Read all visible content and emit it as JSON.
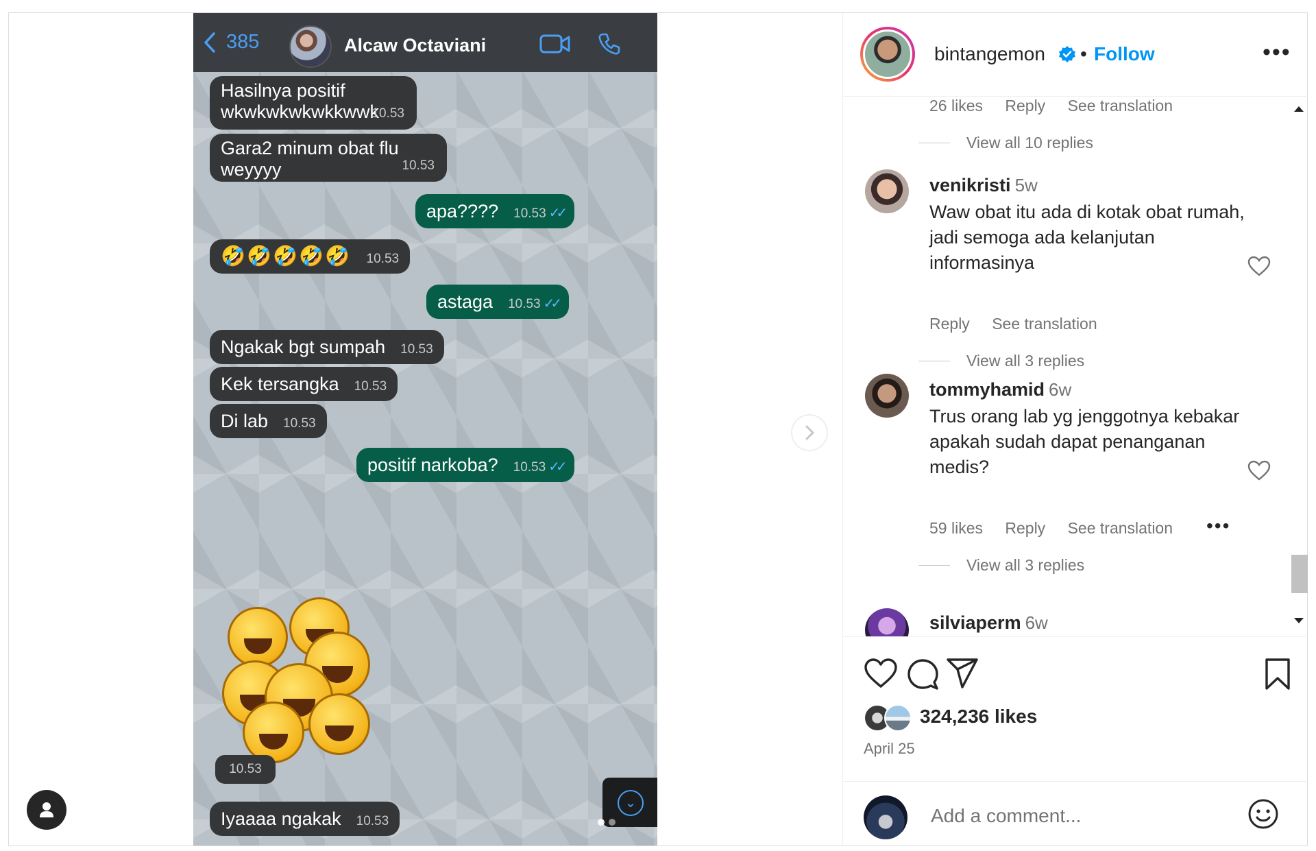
{
  "chat": {
    "unread_count": "385",
    "contact_name": "Alcaw Octaviani",
    "messages": [
      {
        "dir": "in",
        "text_line1": "Hasilnya positif",
        "text_line2": "wkwkwkwkwkkwwk",
        "time": "10.53"
      },
      {
        "dir": "in",
        "text": "Gara2 minum obat flu weyyyy",
        "time": "10.53"
      },
      {
        "dir": "out",
        "text": "apa????",
        "time": "10.53"
      },
      {
        "dir": "in",
        "text": "🤣🤣🤣🤣🤣",
        "time": "10.53"
      },
      {
        "dir": "out",
        "text": "astaga",
        "time": "10.53"
      },
      {
        "dir": "in",
        "text": "Ngakak bgt sumpah",
        "time": "10.53"
      },
      {
        "dir": "in",
        "text": "Kek tersangka",
        "time": "10.53"
      },
      {
        "dir": "in",
        "text": "Di lab",
        "time": "10.53"
      },
      {
        "dir": "out",
        "text": "positif narkoba?",
        "time": "10.53"
      },
      {
        "dir": "in",
        "text": "sticker",
        "time": "10.53"
      },
      {
        "dir": "in",
        "text": "Iyaaaa ngakak",
        "time": "10.53"
      }
    ]
  },
  "post": {
    "owner": "bintangemon",
    "separator": "•",
    "follow_label": "Follow",
    "more_label": "•••",
    "likes": "324,236 likes",
    "date": "April 25",
    "comment_placeholder": "Add a comment..."
  },
  "comments": {
    "top_meta": {
      "likes": "26 likes",
      "reply": "Reply",
      "translate": "See translation"
    },
    "top_replies": "View all 10 replies",
    "items": [
      {
        "user": "venikristi",
        "time": "5w",
        "text": "Waw obat itu ada di kotak obat rumah, jadi semoga ada kelanjutan informasinya",
        "reply": "Reply",
        "translate": "See translation",
        "replies": "View all 3 replies"
      },
      {
        "user": "tommyhamid",
        "time": "6w",
        "text": "Trus orang lab yg jenggotnya kebakar apakah sudah dapat penanganan medis?",
        "likes": "59 likes",
        "reply": "Reply",
        "translate": "See translation",
        "more": "•••",
        "replies": "View all 3 replies"
      },
      {
        "user": "silviaperm",
        "time": "6w"
      }
    ]
  },
  "icons": {
    "back": "chevron-left-icon",
    "video": "video-camera-icon",
    "call": "phone-icon",
    "like": "heart-icon",
    "comment": "comment-icon",
    "share": "paper-plane-icon",
    "save": "bookmark-icon",
    "verified": "verified-badge-icon",
    "emoji": "smiley-icon",
    "next": "chevron-right-icon",
    "profile": "person-icon"
  },
  "colors": {
    "accent": "#0095f6",
    "outgoing_bubble": "#075e48",
    "incoming_bubble": "#353638",
    "chat_header": "#3a3d41",
    "ios_blue": "#4a9ff5"
  }
}
